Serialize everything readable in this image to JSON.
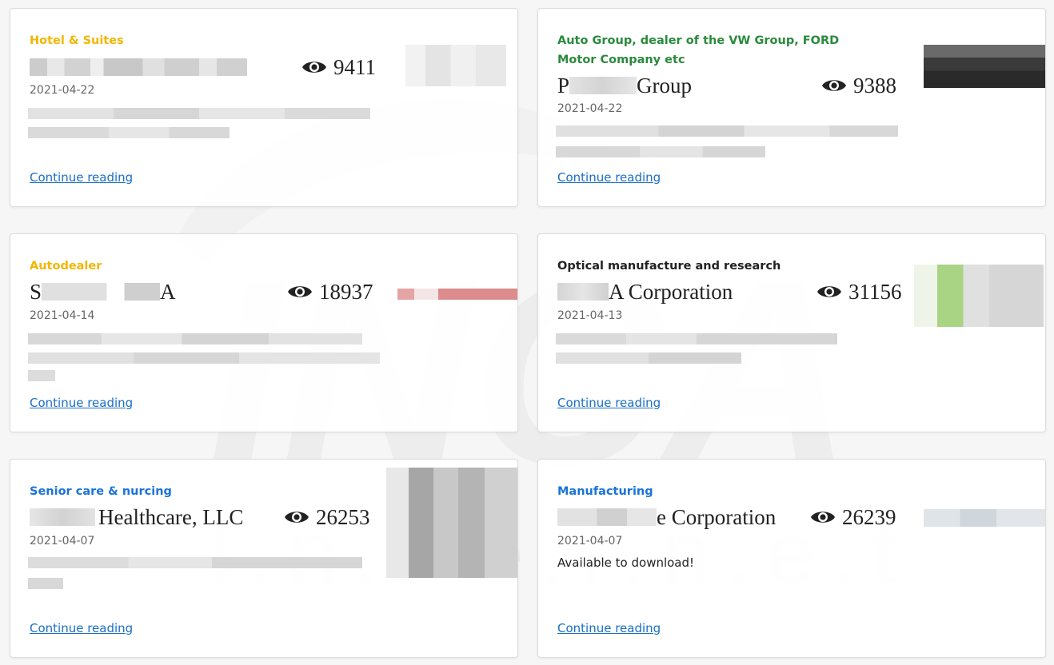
{
  "colors": {
    "amber": "#f2b600",
    "green": "#2a8a3c",
    "black": "#222222",
    "blue": "#1a73d9",
    "link": "#1a6fc4"
  },
  "watermark": {
    "brand": "INCA",
    "tagline": "I.n.t.e.r.n.e.t"
  },
  "cards": [
    {
      "category": "Hotel & Suites",
      "category_color": "amber",
      "title": "",
      "views": "9411",
      "date": "2021-04-22",
      "read_more": "Continue reading"
    },
    {
      "category": "Auto Group, dealer of the VW Group, FORD Motor Company etc",
      "category_color": "green",
      "title_prefix": "P",
      "title": "Group",
      "views": "9388",
      "date": "2021-04-22",
      "read_more": "Continue reading"
    },
    {
      "category": "Autodealer",
      "category_color": "amber",
      "title_prefix": "S",
      "title": "A",
      "views": "18937",
      "date": "2021-04-14",
      "read_more": "Continue reading"
    },
    {
      "category": "Optical manufacture and research",
      "category_color": "black",
      "title": "A Corporation",
      "views": "31156",
      "date": "2021-04-13",
      "read_more": "Continue reading"
    },
    {
      "category": "Senior care & nurcing",
      "category_color": "blue",
      "title": "Healthcare, LLC",
      "views": "26253",
      "date": "2021-04-07",
      "read_more": "Continue reading"
    },
    {
      "category": "Manufacturing",
      "category_color": "blue",
      "title": "e Corporation",
      "views": "26239",
      "date": "2021-04-07",
      "note": "Available to download!",
      "read_more": "Continue reading"
    }
  ]
}
